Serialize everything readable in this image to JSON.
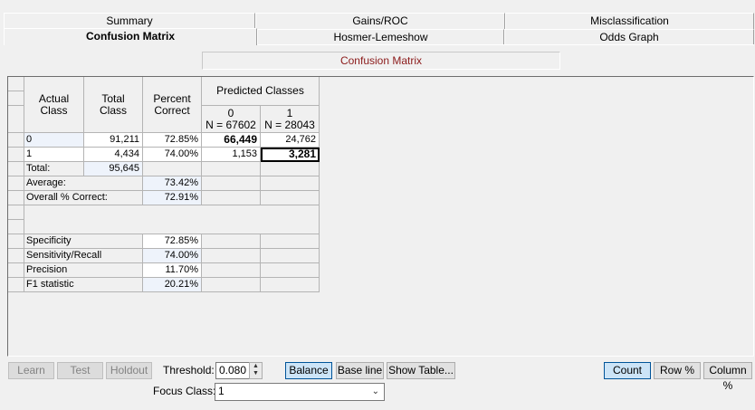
{
  "tabs": {
    "row1": [
      "Summary",
      "Gains/ROC",
      "Misclassification"
    ],
    "row2": [
      "Confusion Matrix",
      "Hosmer-Lemeshow",
      "Odds Graph"
    ]
  },
  "panel_title": "Confusion Matrix",
  "headers": {
    "actual_class": "Actual\nClass",
    "total_class": "Total\nClass",
    "percent_correct": "Percent\nCorrect",
    "predicted_classes": "Predicted Classes",
    "pred0": "0\nN = 67602",
    "pred1": "1\nN = 28043"
  },
  "rows": [
    {
      "label": "0",
      "total": "91,211",
      "pct": "72.85%",
      "p0": "66,449",
      "p1": "24,762"
    },
    {
      "label": "1",
      "total": "4,434",
      "pct": "74.00%",
      "p0": "1,153",
      "p1": "3,281"
    }
  ],
  "total_label": "Total:",
  "total_value": "95,645",
  "average_label": "Average:",
  "average_value": "73.42%",
  "overall_label": "Overall % Correct:",
  "overall_value": "72.91%",
  "metrics": [
    {
      "label": "Specificity",
      "value": "72.85%"
    },
    {
      "label": "Sensitivity/Recall",
      "value": "74.00%"
    },
    {
      "label": "Precision",
      "value": "11.70%"
    },
    {
      "label": "F1 statistic",
      "value": "20.21%"
    }
  ],
  "controls": {
    "learn": "Learn",
    "test": "Test",
    "holdout": "Holdout",
    "threshold_label": "Threshold:",
    "threshold_value": "0.080",
    "balance": "Balance",
    "base_line": "Base line",
    "show_table": "Show Table...",
    "count": "Count",
    "row_pct": "Row %",
    "col_pct": "Column %",
    "focus_label": "Focus Class:",
    "focus_value": "1"
  }
}
